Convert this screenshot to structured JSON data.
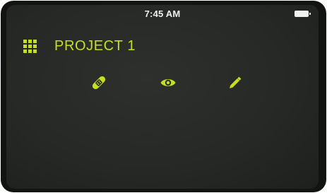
{
  "status_bar": {
    "time": "7:45 AM"
  },
  "header": {
    "menu_icon": "grid-icon",
    "title": "PROJECT 1"
  },
  "tools": [
    {
      "icon": "bandage-icon"
    },
    {
      "icon": "eye-icon"
    },
    {
      "icon": "pencil-icon"
    }
  ],
  "colors": {
    "accent": "#c6df20",
    "screen_background": "#282b27",
    "bezel": "#121412",
    "status_text": "#f2f2f2"
  }
}
